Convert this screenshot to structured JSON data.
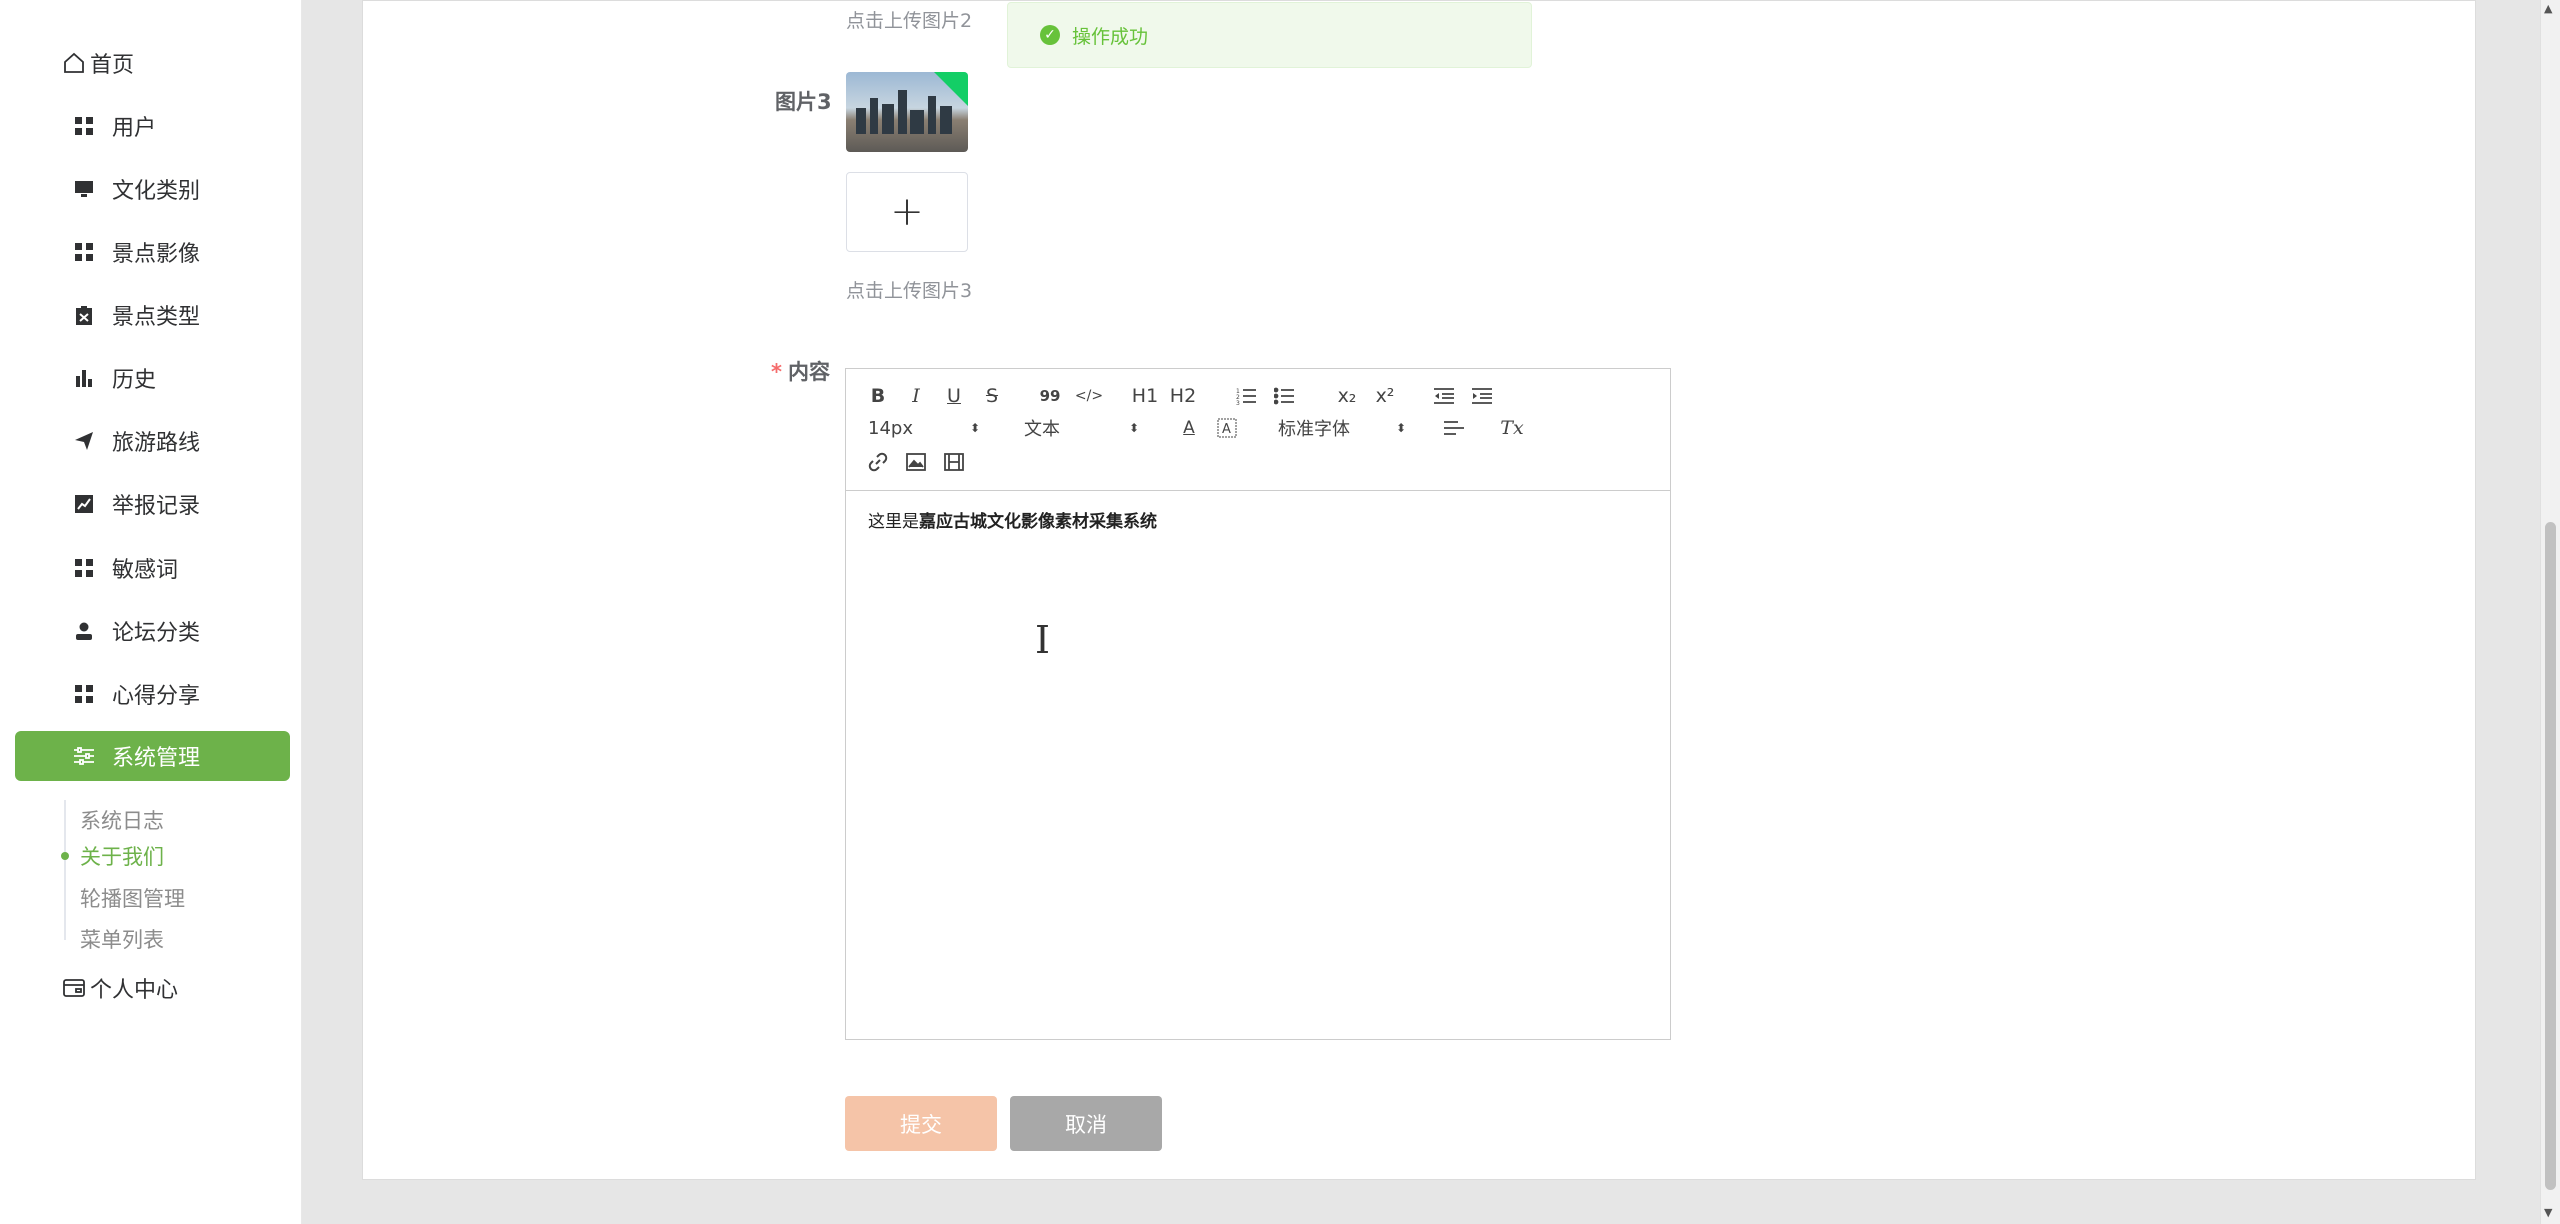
{
  "sidebar": {
    "items": [
      {
        "label": "首页",
        "icon": "home-icon"
      },
      {
        "label": "用户",
        "icon": "grid-icon"
      },
      {
        "label": "文化类别",
        "icon": "monitor-icon"
      },
      {
        "label": "景点影像",
        "icon": "grid-icon"
      },
      {
        "label": "景点类型",
        "icon": "clipboard-icon"
      },
      {
        "label": "历史",
        "icon": "bar-chart-icon"
      },
      {
        "label": "旅游路线",
        "icon": "send-icon"
      },
      {
        "label": "举报记录",
        "icon": "line-chart-icon"
      },
      {
        "label": "敏感词",
        "icon": "grid-icon"
      },
      {
        "label": "论坛分类",
        "icon": "user-icon"
      },
      {
        "label": "心得分享",
        "icon": "grid-icon"
      },
      {
        "label": "系统管理",
        "icon": "sliders-icon"
      },
      {
        "label": "个人中心",
        "icon": "wallet-icon"
      }
    ],
    "sub_items": [
      "系统日志",
      "关于我们",
      "轮播图管理",
      "菜单列表"
    ],
    "active_color": "#6db24a"
  },
  "form": {
    "upload2_hint": "点击上传图片2",
    "image3_label": "图片3",
    "upload3_hint": "点击上传图片3",
    "upload_plus": "+",
    "content_label": "内容",
    "required_mark": "*"
  },
  "toast": {
    "message": "操作成功",
    "color": "#67c23a"
  },
  "editor": {
    "toolbar": {
      "bold": "B",
      "italic": "I",
      "underline": "U",
      "strike": "S",
      "quote": "99",
      "code": "</>",
      "h1": "H1",
      "h2": "H2",
      "sub": "x₂",
      "sup": "x²",
      "size": "14px",
      "header": "文本",
      "font": "标准字体",
      "color": "A",
      "clean": "Tx"
    },
    "content_prefix": "这里是",
    "content_bold": "嘉应古城文化影像素材采集系统"
  },
  "buttons": {
    "submit": "提交",
    "cancel": "取消"
  }
}
